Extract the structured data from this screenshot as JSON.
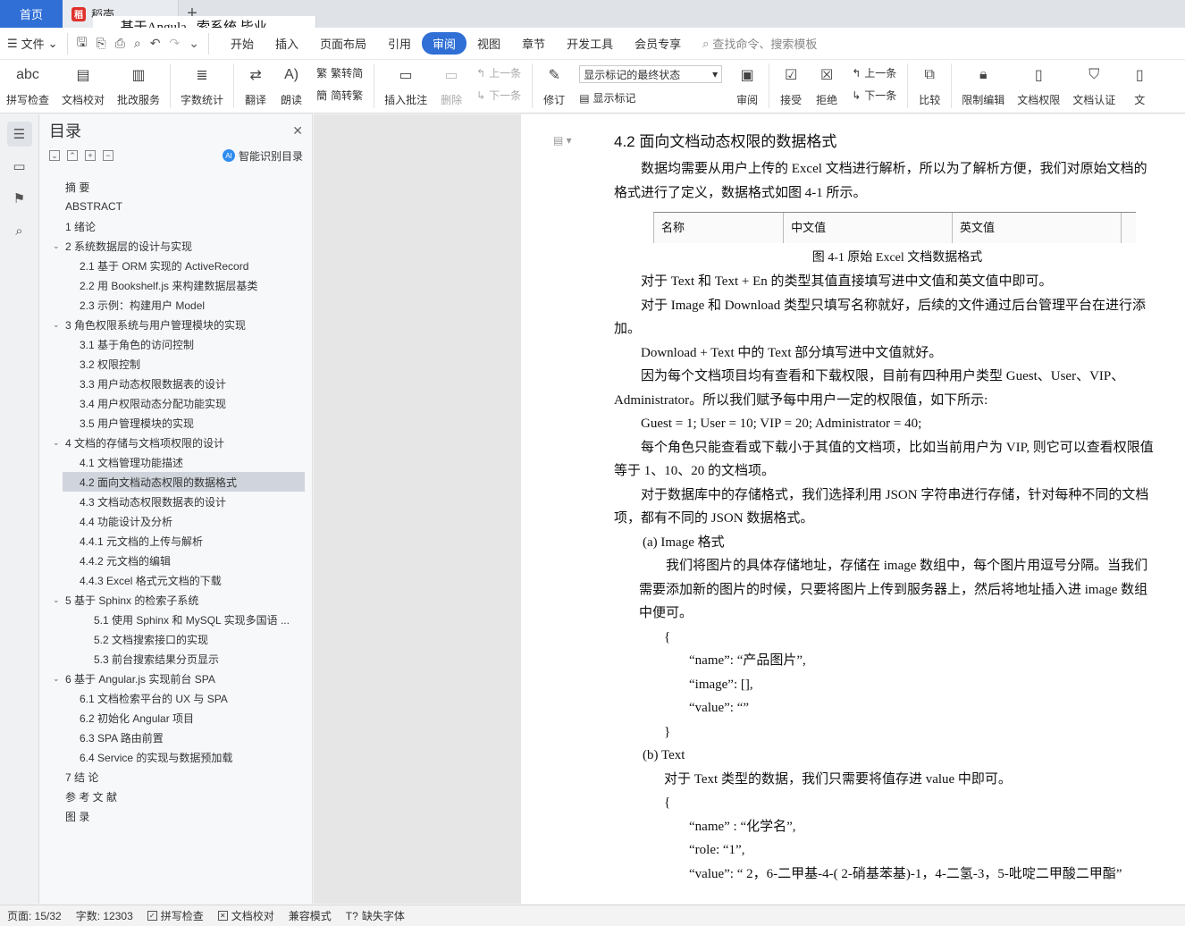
{
  "tabs": {
    "home": "首页",
    "daoke": "稻壳",
    "doc": "基于Angula...索系统 毕业论文"
  },
  "menu": {
    "file": "文件",
    "items": [
      "开始",
      "插入",
      "页面布局",
      "引用",
      "审阅",
      "视图",
      "章节",
      "开发工具",
      "会员专享"
    ],
    "active": "审阅",
    "search": "查找命令、搜索模板"
  },
  "ribbon": {
    "spell": "拼写检查",
    "proofread": "文档校对",
    "annot_service": "批改服务",
    "wordcount": "字数统计",
    "translate": "翻译",
    "read": "朗读",
    "to_trad": "繁转简",
    "to_simp": "简转繁",
    "insert_comment": "插入批注",
    "delete": "删除",
    "prev": "上一条",
    "next": "下一条",
    "revise": "修订",
    "markup_state": "显示标记的最终状态",
    "show_markup": "显示标记",
    "review": "审阅",
    "accept": "接受",
    "reject": "拒绝",
    "prev2": "上一条",
    "next2": "下一条",
    "compare": "比较",
    "restrict": "限制编辑",
    "permission": "文档权限",
    "auth": "文档认证",
    "more": "文"
  },
  "toc": {
    "title": "目录",
    "smart": "智能识别目录",
    "items": [
      {
        "text": "摘  要",
        "level": 1,
        "chev": false
      },
      {
        "text": "ABSTRACT",
        "level": 1,
        "chev": false
      },
      {
        "text": "1  绪论",
        "level": 1,
        "chev": false
      },
      {
        "text": "2  系统数据层的设计与实现",
        "level": 1,
        "chev": true
      },
      {
        "text": "2.1  基于 ORM 实现的 ActiveRecord",
        "level": 2,
        "chev": false
      },
      {
        "text": "2.2  用 Bookshelf.js 来构建数据层基类",
        "level": 2,
        "chev": false
      },
      {
        "text": "2.3  示例：构建用户  Model",
        "level": 2,
        "chev": false
      },
      {
        "text": "3  角色权限系统与用户管理模块的实现",
        "level": 1,
        "chev": true
      },
      {
        "text": "3.1  基于角色的访问控制",
        "level": 2,
        "chev": false
      },
      {
        "text": "3.2  权限控制",
        "level": 2,
        "chev": false
      },
      {
        "text": "3.3  用户动态权限数据表的设计",
        "level": 2,
        "chev": false
      },
      {
        "text": "3.4  用户权限动态分配功能实现",
        "level": 2,
        "chev": false
      },
      {
        "text": "3.5  用户管理模块的实现",
        "level": 2,
        "chev": false
      },
      {
        "text": "4  文档的存储与文档项权限的设计",
        "level": 1,
        "chev": true
      },
      {
        "text": "4.1  文档管理功能描述",
        "level": 2,
        "chev": false
      },
      {
        "text": "4.2  面向文档动态权限的数据格式",
        "level": 2,
        "chev": false,
        "selected": true
      },
      {
        "text": "4.3  文档动态权限数据表的设计",
        "level": 2,
        "chev": false
      },
      {
        "text": "4.4 功能设计及分析",
        "level": 2,
        "chev": false
      },
      {
        "text": "4.4.1  元文档的上传与解析",
        "level": 2,
        "chev": false
      },
      {
        "text": "4.4.2  元文档的编辑",
        "level": 2,
        "chev": false
      },
      {
        "text": "4.4.3 Excel 格式元文档的下载",
        "level": 2,
        "chev": false
      },
      {
        "text": "5  基于 Sphinx 的检索子系统",
        "level": 1,
        "chev": true
      },
      {
        "text": "5.1  使用 Sphinx 和 MySQL 实现多国语 ...",
        "level": 3,
        "chev": false
      },
      {
        "text": "5.2  文档搜索接口的实现",
        "level": 3,
        "chev": false
      },
      {
        "text": "5.3  前台搜索结果分页显示",
        "level": 3,
        "chev": false
      },
      {
        "text": "6  基于 Angular.js  实现前台 SPA",
        "level": 1,
        "chev": true
      },
      {
        "text": "6.1  文档检索平台的  UX  与  SPA",
        "level": 2,
        "chev": false
      },
      {
        "text": "6.2  初始化  Angular  项目",
        "level": 2,
        "chev": false
      },
      {
        "text": "6.3 SPA 路由前置",
        "level": 2,
        "chev": false
      },
      {
        "text": "6.4 Service 的实现与数据预加载",
        "level": 2,
        "chev": false
      },
      {
        "text": "7 结 论",
        "level": 1,
        "chev": false
      },
      {
        "text": "参 考 文 献",
        "level": 1,
        "chev": false
      },
      {
        "text": "图 录",
        "level": 1,
        "chev": false
      }
    ]
  },
  "doc": {
    "heading": "4.2  面向文档动态权限的数据格式",
    "p1": "数据均需要从用户上传的 Excel 文档进行解析，所以为了解析方便，我们对原始文档的格式进行了定义，数据格式如图 4-1 所示。",
    "table": [
      "名称",
      "中文值",
      "英文值"
    ],
    "caption": "图 4-1  原始 Excel 文档数据格式",
    "p2": "对于 Text  和  Text + En 的类型其值直接填写进中文值和英文值中即可。",
    "p3": "对于 Image  和  Download 类型只填写名称就好，后续的文件通过后台管理平台在进行添加。",
    "p4": "Download + Text 中的 Text 部分填写进中文值就好。",
    "p5": "因为每个文档项目均有查看和下载权限，目前有四种用户类型 Guest、User、VIP、Administrator。所以我们赋予每中用户一定的权限值，如下所示:",
    "p6": "Guest = 1;    User = 10;    VIP = 20;    Administrator = 40;",
    "p7": "每个角色只能查看或下载小于其值的文档项，比如当前用户为 VIP, 则它可以查看权限值等于 1、10、20 的文档项。",
    "p8": "对于数据库中的存储格式，我们选择利用 JSON 字符串进行存储，针对每种不同的文档项，都有不同的 JSON 数据格式。",
    "a_title": "(a)  Image 格式",
    "a_body": "我们将图片的具体存储地址，存储在 image 数组中，每个图片用逗号分隔。当我们需要添加新的图片的时候，只要将图片上传到服务器上，然后将地址插入进 image 数组中便可。",
    "brace_open": "{",
    "brace_close": "}",
    "a_l1": "“name”: “产品图片”,",
    "a_l2": "“image”: [],",
    "a_l3": "“value”: “”",
    "b_title": "(b)  Text",
    "b_body": "对于 Text 类型的数据，我们只需要将值存进 value 中即可。",
    "b_l1": "“name” : “化学名”,",
    "b_l2": "“role: “1”,",
    "b_l3": "“value”: “ 2，6-二甲基-4-( 2-硝基苯基)-1，4-二氢-3，5-吡啶二甲酸二甲酯”"
  },
  "status": {
    "page": "页面: 15/32",
    "words": "字数: 12303",
    "spell": "拼写检查",
    "proof": "文档校对",
    "compat": "兼容模式",
    "missing_font": "缺失字体"
  }
}
